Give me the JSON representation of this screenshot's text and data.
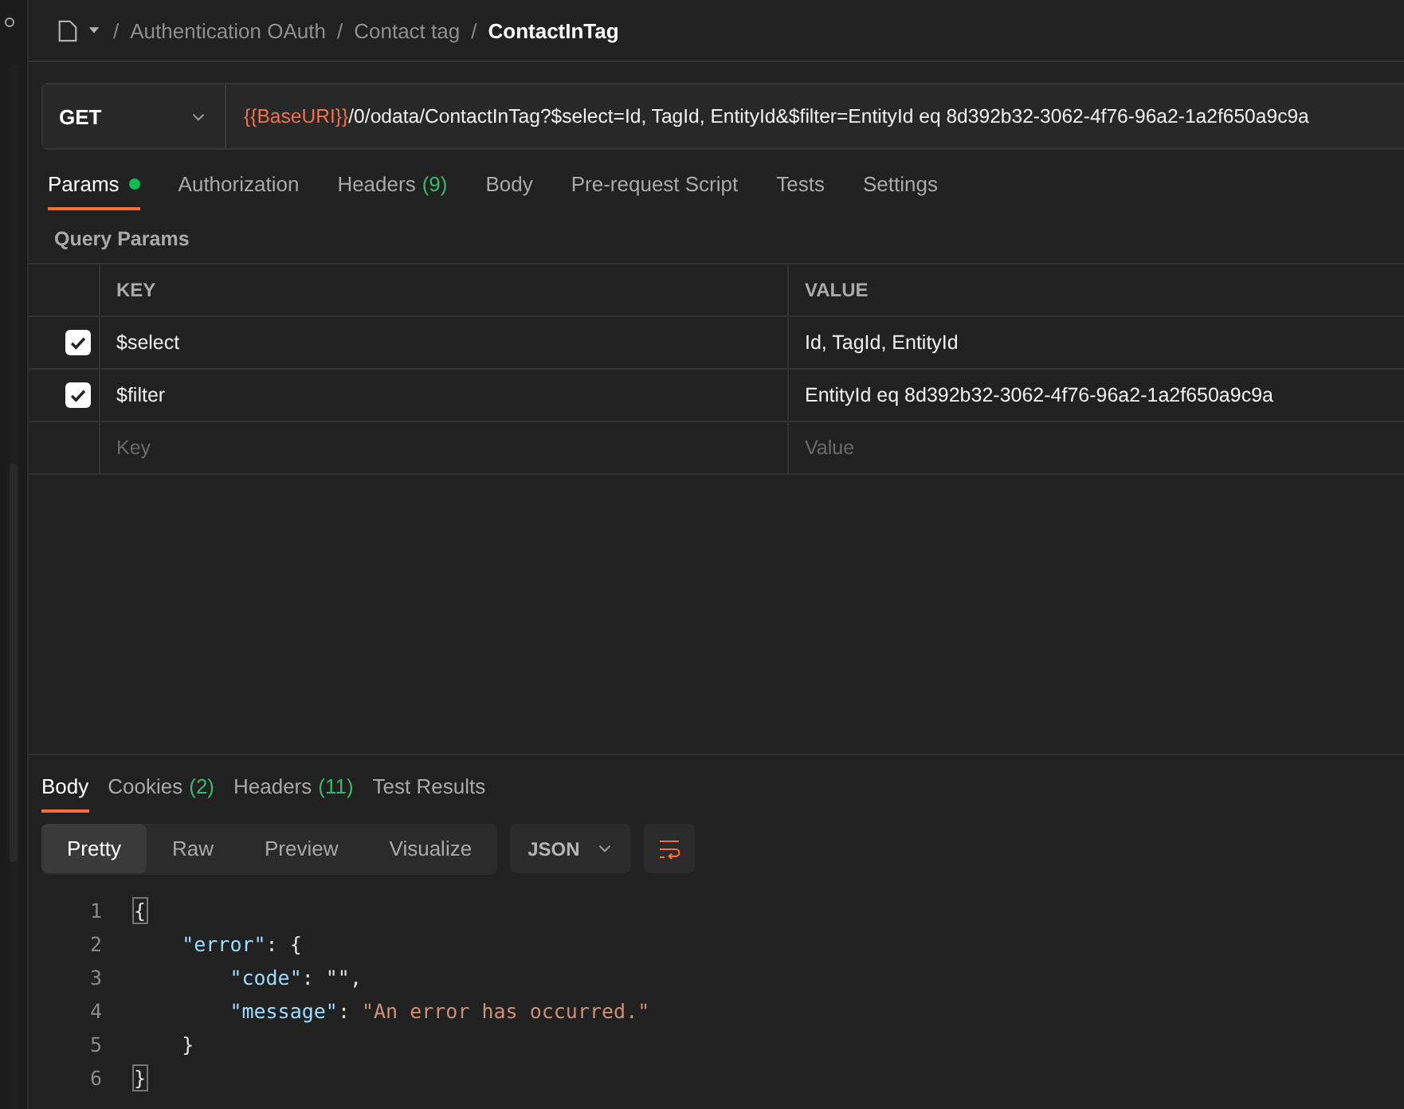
{
  "breadcrumb": {
    "items": [
      {
        "text": "Authentication OAuth",
        "current": false
      },
      {
        "text": "Contact tag",
        "current": false
      },
      {
        "text": "ContactInTag",
        "current": true
      }
    ],
    "separator": "/"
  },
  "request": {
    "method": "GET",
    "url_variable": "{{BaseURI}}",
    "url_rest": "/0/odata/ContactInTag?$select=Id, TagId, EntityId&$filter=EntityId eq 8d392b32-3062-4f76-96a2-1a2f650a9c9a"
  },
  "request_tabs": [
    {
      "label": "Params",
      "dot": true,
      "selected": true
    },
    {
      "label": "Authorization",
      "dot": false,
      "selected": false
    },
    {
      "label": "Headers",
      "count": "(9)",
      "dot": false,
      "selected": false
    },
    {
      "label": "Body",
      "dot": false,
      "selected": false
    },
    {
      "label": "Pre-request Script",
      "dot": false,
      "selected": false
    },
    {
      "label": "Tests",
      "dot": false,
      "selected": false
    },
    {
      "label": "Settings",
      "dot": false,
      "selected": false
    }
  ],
  "query_params": {
    "title": "Query Params",
    "columns": [
      "KEY",
      "VALUE"
    ],
    "rows": [
      {
        "key": "$select",
        "value": "Id, TagId, EntityId",
        "checked": true
      },
      {
        "key": "$filter",
        "value": "EntityId eq 8d392b32-3062-4f76-96a2-1a2f650a9c9a",
        "checked": true
      }
    ],
    "new_row": {
      "key_placeholder": "Key",
      "value_placeholder": "Value"
    }
  },
  "response_tabs": [
    {
      "label": "Body",
      "selected": true
    },
    {
      "label": "Cookies",
      "count": "(2)",
      "selected": false
    },
    {
      "label": "Headers",
      "count": "(11)",
      "selected": false
    },
    {
      "label": "Test Results",
      "selected": false
    }
  ],
  "view_modes": [
    {
      "label": "Pretty",
      "selected": true
    },
    {
      "label": "Raw",
      "selected": false
    },
    {
      "label": "Preview",
      "selected": false
    },
    {
      "label": "Visualize",
      "selected": false
    }
  ],
  "format": "JSON",
  "code_lines": [
    {
      "number": "1",
      "tokens": [
        {
          "kind": "punct",
          "text": "{",
          "highlight": true
        }
      ]
    },
    {
      "number": "2",
      "tokens": [
        {
          "kind": "key",
          "text": "    \"error\""
        },
        {
          "kind": "punct",
          "text": ": {"
        }
      ]
    },
    {
      "number": "3",
      "tokens": [
        {
          "kind": "key",
          "text": "        \"code\""
        },
        {
          "kind": "punct",
          "text": ": \"\","
        }
      ]
    },
    {
      "number": "4",
      "tokens": [
        {
          "kind": "key",
          "text": "        \"message\""
        },
        {
          "kind": "punct",
          "text": ": "
        },
        {
          "kind": "string",
          "text": "\"An error has occurred.\""
        }
      ]
    },
    {
      "number": "5",
      "tokens": [
        {
          "kind": "punct",
          "text": "    }"
        }
      ]
    },
    {
      "number": "6",
      "tokens": [
        {
          "kind": "punct",
          "text": "}",
          "highlight": true
        }
      ]
    }
  ]
}
